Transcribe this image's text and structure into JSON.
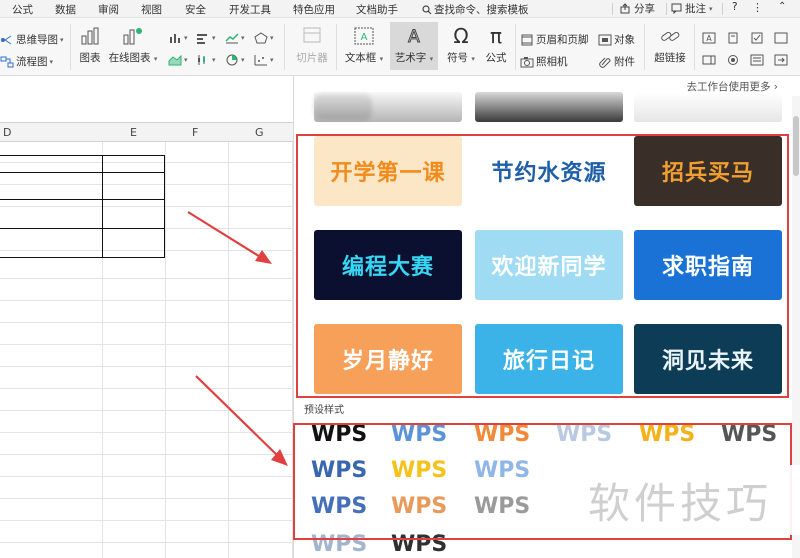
{
  "menubar": {
    "items": [
      "公式",
      "数据",
      "审阅",
      "视图",
      "安全",
      "开发工具",
      "特色应用",
      "文档助手",
      "查找命令、搜索模板"
    ],
    "share": "分享",
    "comment": "批注",
    "help": "?"
  },
  "ribbon": {
    "mindmap": "思维导图",
    "flowchart": "流程图",
    "chart": "图表",
    "online_chart": "在线图表",
    "slicer": "切片器",
    "textbox": "文本框",
    "wordart": "艺术字",
    "symbol": "符号",
    "formula": "公式",
    "header_footer": "页眉和页脚",
    "object": "对象",
    "camera": "照相机",
    "attachment": "附件",
    "hyperlink": "超链接"
  },
  "sheet": {
    "columns": [
      "D",
      "E",
      "F",
      "G"
    ]
  },
  "panel": {
    "top_link": "去工作台使用更多 ›",
    "thumbnails": [
      {
        "text": "开学第一课",
        "bg": "#fbe7c6",
        "color": "#f28a1c"
      },
      {
        "text": "节约水资源",
        "bg": "#ffffff",
        "color": "#1f5fa8"
      },
      {
        "text": "招兵买马",
        "bg": "#3a2e28",
        "color": "#f0a030"
      },
      {
        "text": "编程大赛",
        "bg": "#0b1030",
        "color": "#37d6f2"
      },
      {
        "text": "欢迎新同学",
        "bg": "#9fdcf3",
        "color": "#ffffff"
      },
      {
        "text": "求职指南",
        "bg": "#1a72d6",
        "color": "#ffffff"
      },
      {
        "text": "岁月静好",
        "bg": "#f6a05a",
        "color": "#ffffff"
      },
      {
        "text": "旅行日记",
        "bg": "#3bb2e8",
        "color": "#ffffff"
      },
      {
        "text": "洞见未来",
        "bg": "#0d3c56",
        "color": "#e9f4f8"
      }
    ],
    "preset_label": "预设样式",
    "wps_styles": [
      {
        "text": "WPS",
        "color": "#111111"
      },
      {
        "text": "WPS",
        "color": "#5b93d6"
      },
      {
        "text": "WPS",
        "color": "#f08a3a"
      },
      {
        "text": "WPS",
        "color": "#b9c9e3"
      },
      {
        "text": "WPS",
        "color": "#f2b21a"
      },
      {
        "text": "WPS",
        "color": "#555555"
      },
      {
        "text": "WPS",
        "color": "#3a66b0"
      },
      {
        "text": "WPS",
        "color": "#f5c21c"
      },
      {
        "text": "WPS",
        "color": "#8fb6e6"
      },
      {
        "text": "WPS",
        "color": "#4570b8"
      },
      {
        "text": "WPS",
        "color": "#e79a5a"
      },
      {
        "text": "WPS",
        "color": "#9a9a9a"
      },
      {
        "text": "WPS",
        "color": "#a3b4cf"
      },
      {
        "text": "WPS",
        "color": "#303030"
      }
    ]
  },
  "watermark": "软件技巧",
  "colors": {
    "annotation": "#e04040",
    "selected_tab": "#d9d9d9"
  }
}
